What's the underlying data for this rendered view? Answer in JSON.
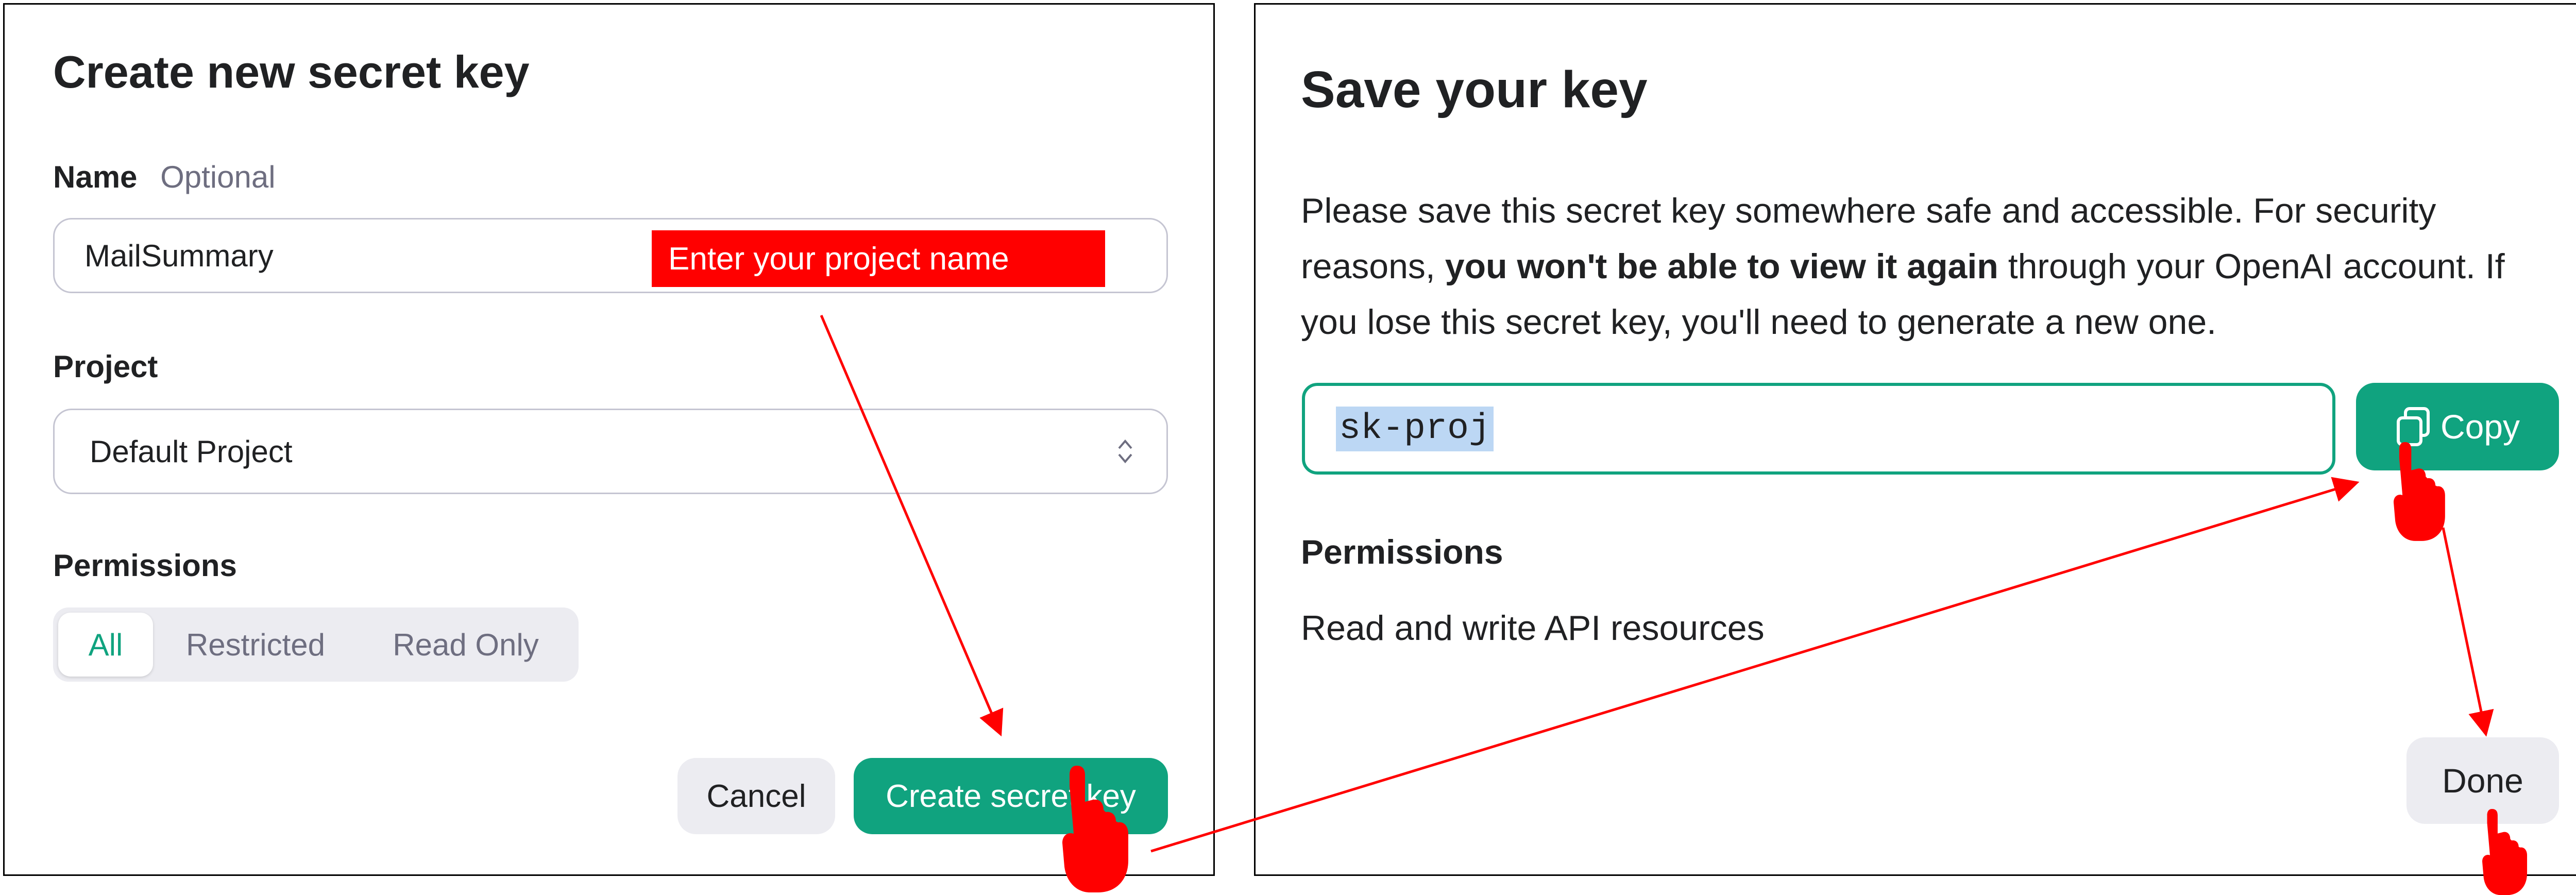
{
  "create_dialog": {
    "title": "Create new secret key",
    "name_label": "Name",
    "name_optional": "Optional",
    "name_value": "MailSummary",
    "name_callout": "Enter your project name",
    "project_label": "Project",
    "project_value": "Default Project",
    "permissions_label": "Permissions",
    "permission_tabs": [
      "All",
      "Restricted",
      "Read Only"
    ],
    "permission_selected": "All",
    "cancel_label": "Cancel",
    "create_label": "Create secret key"
  },
  "save_dialog": {
    "title": "Save your key",
    "description_part1": "Please save this secret key somewhere safe and accessible. For security reasons, ",
    "description_bold": "you won't be able to view it again",
    "description_part2": " through your OpenAI account. If you lose this secret key, you'll need to generate a new one.",
    "key_value": "sk-proj",
    "copy_label": "Copy",
    "permissions_label": "Permissions",
    "permissions_value": "Read and write API resources",
    "done_label": "Done"
  },
  "colors": {
    "accent": "#10a37f",
    "annotation": "#ff0000",
    "selection": "#bcd7f4"
  },
  "icons": [
    "chevron-updown-icon",
    "copy-icon",
    "pointer-hand-icon",
    "arrow-annotation"
  ]
}
